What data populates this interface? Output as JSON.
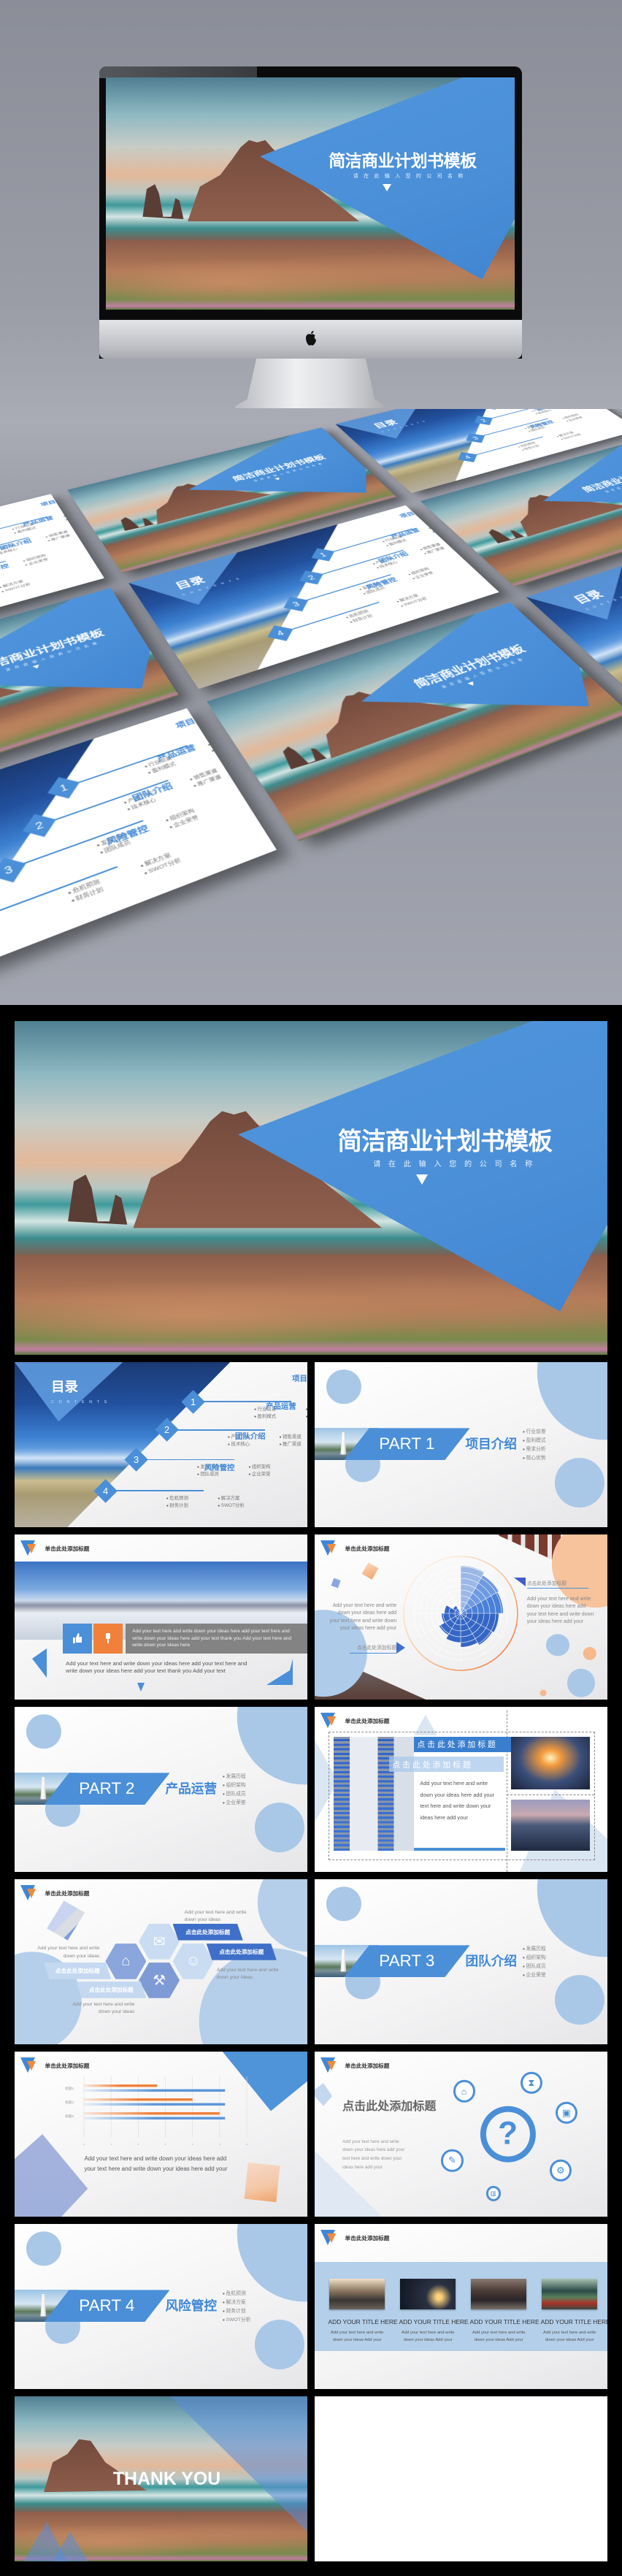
{
  "hero": {
    "title": "简洁商业计划书模板",
    "subtitle": "请在此输入您的公司名称"
  },
  "header_title": "单击此处添加标题",
  "toc": {
    "title": "目录",
    "subtitle": "CONTENTS",
    "items": [
      {
        "num": "1",
        "title": "项目介绍",
        "bullets": [
          "行业前景",
          "需求分析",
          "盈利模式",
          "核心优势"
        ]
      },
      {
        "num": "2",
        "title": "产品运营",
        "bullets": [
          "产品介绍",
          "销售渠道",
          "技术核心",
          "推广渠道"
        ]
      },
      {
        "num": "3",
        "title": "团队介绍",
        "bullets": [
          "发展历程",
          "组织架构",
          "团队成员",
          "企业荣誉"
        ]
      },
      {
        "num": "4",
        "title": "风险管控",
        "bullets": [
          "危机预测",
          "解决方案",
          "财务计划",
          "SWOT分析"
        ]
      }
    ]
  },
  "parts": [
    {
      "label": "PART 1",
      "title": "项目介绍",
      "bullets": [
        "行业前景",
        "盈利模式",
        "需求分析",
        "核心优势"
      ]
    },
    {
      "label": "PART 2",
      "title": "产品运营",
      "bullets": [
        "发展历程",
        "组织架构",
        "团队成员",
        "企业荣誉"
      ]
    },
    {
      "label": "PART 3",
      "title": "团队介绍",
      "bullets": [
        "发展历程",
        "组织架构",
        "团队成员",
        "企业荣誉"
      ]
    },
    {
      "label": "PART 4",
      "title": "风险管控",
      "bullets": [
        "危机预测",
        "解决方案",
        "财务计划",
        "SWOT分析"
      ]
    }
  ],
  "slide_photo_text": {
    "box_text": "Add your text here and write down your ideas here add your text here and write down your ideas here add your text  thank you Add your text here and write down your ideas here",
    "body": "Add your text here and  write down your ideas here add your text here and write down your ideas here add your text  thank you Add your text"
  },
  "slide_polar": {
    "left_text": "Add your text here and write down your ideas here add your text here and write down your ideas here add your",
    "left_caption": "点击此处添加标题",
    "right_caption": "点击此处添加标题",
    "right_text": "Add your text here and write down your ideas here add your text here and write down your ideas here add your"
  },
  "slide_frame": {
    "title": "点 击 此 处 添 加 标 题",
    "subtitle": "点 击 此 处 添 加 标 题",
    "text": "Add your text here and write down your ideas here add your text here and write down your ideas here add your"
  },
  "slide_hex": {
    "labels": [
      "点击此处添加标题",
      "点击此处添加标题",
      "点击此处添加标题",
      "点击此处添加标题"
    ],
    "texts": [
      "Add your text here and write down your ideas",
      "Add your text here and write down your ideas",
      "Add your text here and write down your ideas",
      "Add your text here and write down your ideas"
    ]
  },
  "chart_data": {
    "type": "bar",
    "orientation": "horizontal",
    "categories": [
      "标题1",
      "标题2",
      "标题3"
    ],
    "series": [
      {
        "values": [
          2.7,
          4.0,
          5.0
        ],
        "color": "#f0803a"
      },
      {
        "values": [
          5.2,
          5.2,
          5.2
        ],
        "color": "#5a95d8"
      }
    ],
    "xticks": [
      "0",
      "1",
      "2",
      "3",
      "4",
      "5",
      "6"
    ],
    "xlim": [
      0,
      6
    ],
    "grid": true,
    "caption": "Add your text here and write down your ideas here add your text here and write down your ideas here add your"
  },
  "slide_question": {
    "title": "点击此处添加标题",
    "text": "Add your text here and write down your ideas here add your text here and write down your ideas here add your",
    "icons": [
      "home-icon",
      "hourglass-icon",
      "briefcase-icon",
      "gear-icon",
      "bar-chart-icon",
      "document-icon",
      "question-icon"
    ]
  },
  "cards": [
    {
      "title": "ADD YOUR TITLE HERE",
      "text": "Add your text here and write down your ideas Add your"
    },
    {
      "title": "ADD YOUR TITLE HERE",
      "text": "Add your text here and write down your ideas Add your"
    },
    {
      "title": "ADD YOUR TITLE HERE",
      "text": "Add your text here and write down your ideas Add your"
    },
    {
      "title": "ADD YOUR TITLE HERE",
      "text": "Add your text here and write down your ideas Add your"
    }
  ],
  "thanks": "THANK YOU",
  "colors": {
    "accent": "#4a8fd8",
    "dark_blue": "#2456a8",
    "orange": "#f0803a",
    "light_blue": "#a9c8e8"
  }
}
